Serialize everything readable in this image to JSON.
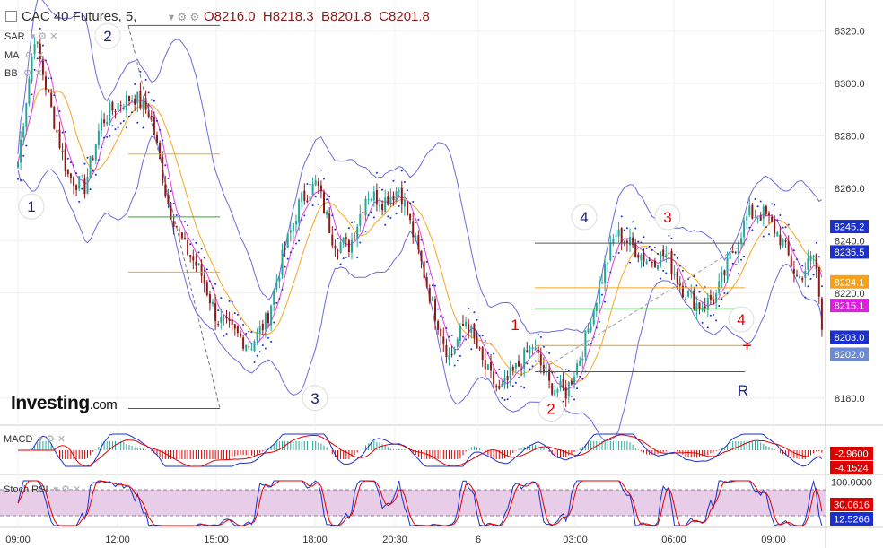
{
  "header": {
    "title": "CAC 40 Futures, 5,",
    "ohlc": [
      "O8216.0",
      "H8218.3",
      "B8201.8",
      "C8201.8"
    ]
  },
  "indicators": [
    "SAR",
    "MA",
    "BB"
  ],
  "logo": {
    "main": "Investing",
    "suffix": ".com"
  },
  "price_axis": {
    "ticks": [
      "8320.0",
      "8300.0",
      "8280.0",
      "8260.0",
      "8240.0",
      "8220.0",
      "8180.0"
    ]
  },
  "time_axis": {
    "ticks": [
      "09:00",
      "12:00",
      "15:00",
      "18:00",
      "20:30",
      "6",
      "03:00",
      "06:00",
      "09:00"
    ]
  },
  "price_tags": [
    {
      "label": "8245.2",
      "color": "#1a2fd0"
    },
    {
      "label": "8235.5",
      "color": "#1a2fd0"
    },
    {
      "label": "8224.1",
      "color": "#f7a11a"
    },
    {
      "label": "8215.1",
      "color": "#e020e0"
    },
    {
      "label": "8203.0",
      "color": "#1a2fd0"
    },
    {
      "label": "8202.0",
      "color": "#6a8bd8"
    }
  ],
  "wave_labels": [
    {
      "text": "1",
      "color": "#1a237e",
      "circle": true
    },
    {
      "text": "2",
      "color": "#1a237e",
      "circle": true
    },
    {
      "text": "3",
      "color": "#1a237e",
      "circle": true
    },
    {
      "text": "1",
      "color": "#e00000",
      "circle": false
    },
    {
      "text": "2",
      "color": "#e00000",
      "circle": true
    },
    {
      "text": "3",
      "color": "#e00000",
      "circle": true
    },
    {
      "text": "4",
      "color": "#1a237e",
      "circle": true
    },
    {
      "text": "4",
      "color": "#e00000",
      "circle": true
    },
    {
      "text": "R",
      "color": "#1a237e",
      "circle": false
    }
  ],
  "macd": {
    "title": "MACD",
    "values": [
      "-2.9600",
      "-4.1524"
    ],
    "colors": [
      "#e00000",
      "#e00000"
    ]
  },
  "stoch": {
    "title": "Stoch RSI",
    "values": [
      "100.0000",
      "30.0616",
      "12.5266"
    ],
    "colors": [
      "#ffffff",
      "#e00000",
      "#1a2fd0"
    ]
  },
  "colors": {
    "up": "#26a69a",
    "down": "#8b1a1a",
    "bb": "#6b6bdb",
    "ma_fast": "#e040e0",
    "ma_slow": "#f5a623",
    "sar": "#1a2fd0"
  },
  "chart_data": {
    "type": "candlestick",
    "symbol": "CAC 40 Futures",
    "interval": "5",
    "ylim": [
      8170,
      8330
    ],
    "close_anchors": [
      [
        "09:00",
        8270
      ],
      [
        "09:30",
        8318
      ],
      [
        "10:00",
        8290
      ],
      [
        "10:30",
        8265
      ],
      [
        "11:00",
        8260
      ],
      [
        "11:30",
        8285
      ],
      [
        "12:00",
        8292
      ],
      [
        "12:30",
        8295
      ],
      [
        "13:00",
        8288
      ],
      [
        "13:30",
        8255
      ],
      [
        "14:00",
        8238
      ],
      [
        "14:30",
        8228
      ],
      [
        "15:00",
        8210
      ],
      [
        "15:30",
        8205
      ],
      [
        "16:00",
        8200
      ],
      [
        "16:30",
        8210
      ],
      [
        "17:00",
        8235
      ],
      [
        "17:30",
        8255
      ],
      [
        "18:00",
        8262
      ],
      [
        "18:30",
        8240
      ],
      [
        "19:00",
        8238
      ],
      [
        "19:30",
        8258
      ],
      [
        "20:00",
        8255
      ],
      [
        "20:30",
        8260
      ],
      [
        "21:00",
        8238
      ],
      [
        "21:30",
        8215
      ],
      [
        "22:00",
        8195
      ],
      [
        "22:30",
        8210
      ],
      [
        "23:00",
        8193
      ],
      [
        "23:30",
        8182
      ],
      [
        "00:30",
        8200
      ],
      [
        "01:00",
        8185
      ],
      [
        "01:30",
        8182
      ],
      [
        "02:00",
        8198
      ],
      [
        "02:30",
        8222
      ],
      [
        "03:00",
        8243
      ],
      [
        "03:30",
        8238
      ],
      [
        "04:00",
        8232
      ],
      [
        "04:30",
        8235
      ],
      [
        "05:00",
        8222
      ],
      [
        "05:30",
        8215
      ],
      [
        "06:00",
        8218
      ],
      [
        "06:30",
        8235
      ],
      [
        "07:00",
        8250
      ],
      [
        "07:30",
        8250
      ],
      [
        "08:00",
        8240
      ],
      [
        "08:30",
        8225
      ],
      [
        "09:00",
        8235
      ],
      [
        "09:15",
        8202
      ]
    ],
    "levels": [
      8322,
      8273,
      8249,
      8239,
      8228,
      8222,
      8214,
      8200,
      8190,
      8176
    ],
    "macd_last": [
      -2.96,
      -4.1524
    ],
    "stoch_rsi_last": [
      30.0616,
      12.5266
    ],
    "stoch_rsi_ylim": [
      0,
      100
    ]
  }
}
